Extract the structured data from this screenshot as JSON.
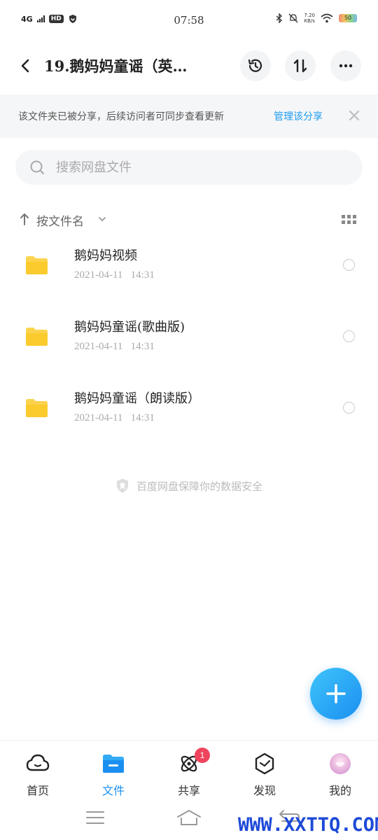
{
  "status_bar": {
    "network": "4G",
    "hd": "HD",
    "time": "07:58",
    "speed_value": "7.20",
    "speed_unit": "KB/s",
    "battery": "50"
  },
  "header": {
    "title": "19.鹅妈妈童谣（英…"
  },
  "banner": {
    "text": "该文件夹已被分享，后续访问者可同步查看更新",
    "link": "管理该分享"
  },
  "search": {
    "placeholder": "搜索网盘文件"
  },
  "sort": {
    "label": "按文件名"
  },
  "files": [
    {
      "name": "鹅妈妈视频",
      "date": "2021-04-11   14:31"
    },
    {
      "name": "鹅妈妈童谣(歌曲版)",
      "date": "2021-04-11   14:31"
    },
    {
      "name": "鹅妈妈童谣（朗读版）",
      "date": "2021-04-11   14:31"
    }
  ],
  "security_note": "百度网盘保障你的数据安全",
  "tabs": [
    {
      "label": "首页"
    },
    {
      "label": "文件"
    },
    {
      "label": "共享",
      "badge": "1"
    },
    {
      "label": "发现"
    },
    {
      "label": "我的"
    }
  ],
  "colors": {
    "accent": "#1a8ff0",
    "folder": "#fcd34d",
    "badge": "#f0445e",
    "watermark": "#1d4ad8"
  },
  "watermark": "WWW.XXTTQ.COM"
}
